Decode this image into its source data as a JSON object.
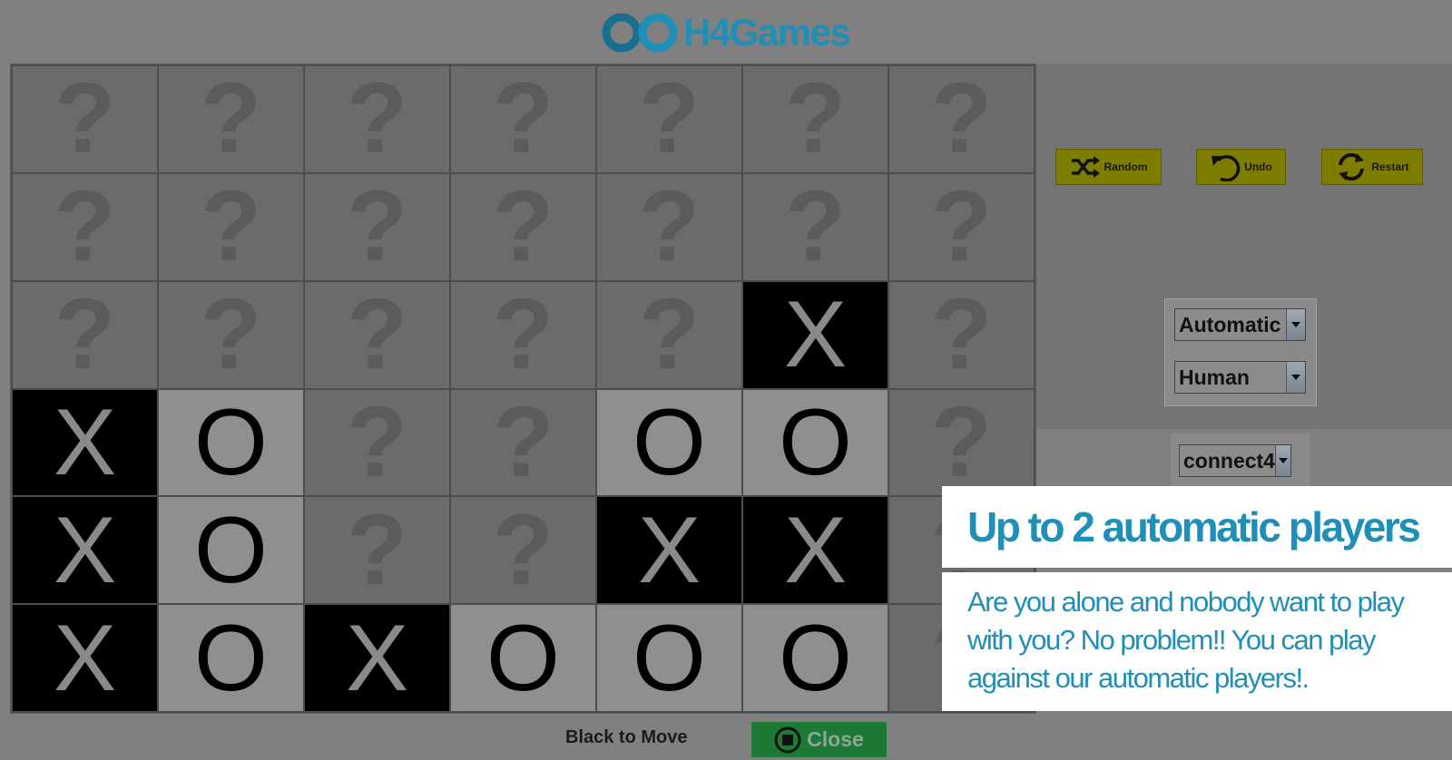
{
  "brand": {
    "name": "H4Games",
    "color": "#1f8fb8"
  },
  "board": {
    "rows": [
      [
        "?",
        "?",
        "?",
        "?",
        "?",
        "?",
        "?"
      ],
      [
        "?",
        "?",
        "?",
        "?",
        "?",
        "?",
        "?"
      ],
      [
        "?",
        "?",
        "?",
        "?",
        "?",
        "X",
        "?"
      ],
      [
        "X",
        "O",
        "?",
        "?",
        "O",
        "O",
        "?"
      ],
      [
        "X",
        "O",
        "?",
        "?",
        "X",
        "X",
        "?"
      ],
      [
        "X",
        "O",
        "X",
        "O",
        "O",
        "O",
        "?"
      ]
    ]
  },
  "toolbar": {
    "random_label": "Random",
    "undo_label": "Undo",
    "restart_label": "Restart",
    "button_color": "#7f7d00"
  },
  "players": {
    "player1": "Automatic",
    "player2": "Human"
  },
  "game_select": {
    "value": "connect4"
  },
  "info": {
    "title": "Up to 2 automatic players",
    "body": "Are you alone and nobody want to play with you? No problem!! You can play against our automatic players!."
  },
  "status": {
    "text": "Black to Move"
  },
  "close": {
    "label": "Close",
    "color": "#1d7a36"
  }
}
